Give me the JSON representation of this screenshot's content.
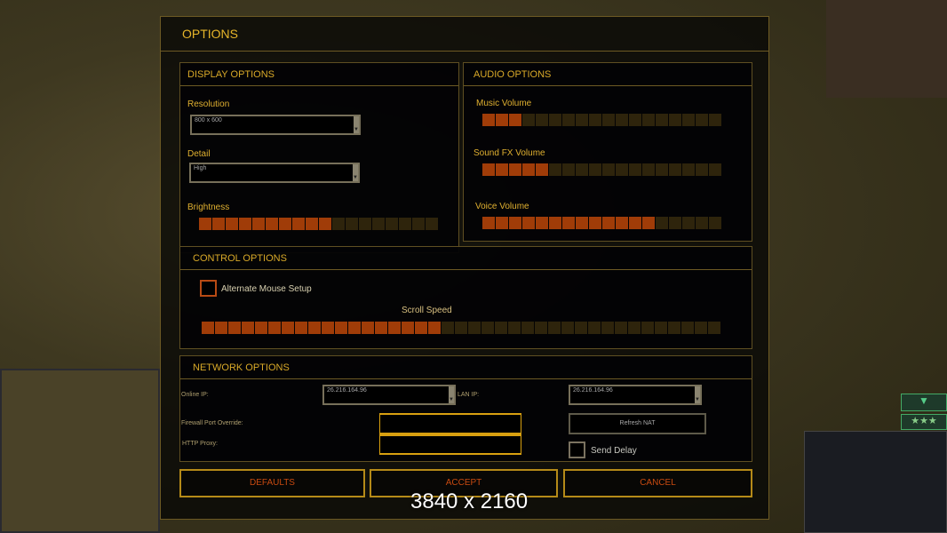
{
  "dialog": {
    "title": "OPTIONS"
  },
  "display": {
    "header": "DISPLAY OPTIONS",
    "resolution_label": "Resolution",
    "resolution_value": "800 x 600",
    "detail_label": "Detail",
    "detail_value": "High",
    "brightness_label": "Brightness",
    "brightness": {
      "filled": 10,
      "total": 18
    }
  },
  "audio": {
    "header": "AUDIO OPTIONS",
    "music_label": "Music Volume",
    "music": {
      "filled": 3,
      "total": 18
    },
    "sfx_label": "Sound FX Volume",
    "sfx": {
      "filled": 5,
      "total": 18
    },
    "voice_label": "Voice Volume",
    "voice": {
      "filled": 13,
      "total": 18
    }
  },
  "control": {
    "header": "CONTROL OPTIONS",
    "alt_mouse_label": "Alternate Mouse Setup",
    "scroll_label": "Scroll Speed",
    "scroll": {
      "filled": 18,
      "total": 39
    }
  },
  "network": {
    "header": "NETWORK OPTIONS",
    "online_ip_label": "Online IP:",
    "online_ip_value": "26.216.164.96",
    "lan_ip_label": "LAN IP:",
    "lan_ip_value": "26.216.164.96",
    "firewall_label": "Firewall Port Override:",
    "http_proxy_label": "HTTP Proxy:",
    "refresh_nat": "Refresh NAT",
    "send_delay_label": "Send Delay"
  },
  "buttons": {
    "defaults": "DEFAULTS",
    "accept": "ACCEPT",
    "cancel": "CANCEL"
  },
  "overlay": {
    "resolution_text": "3840 x 2160"
  },
  "colors": {
    "accent": "#e6b52a",
    "slider_on": "#a03c08",
    "slider_off": "#2e240c",
    "button_text": "#c84a10"
  }
}
